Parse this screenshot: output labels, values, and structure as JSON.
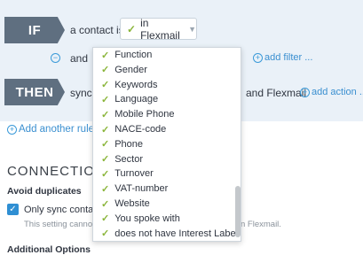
{
  "rule": {
    "if_tag": "IF",
    "condition_prefix": "a contact is",
    "condition_value": "in Flexmail",
    "and_label": "and",
    "add_filter": "add filter ...",
    "then_tag": "THEN",
    "action_prefix": "sync t",
    "action_suffix": "and Flexmail",
    "add_action": "add action ..."
  },
  "add_rule": "Add another rule .",
  "connections": {
    "title": "CONNECTION",
    "avoid_duplicates": "Avoid duplicates",
    "checkbox_label": "Only sync contac",
    "hint_left": "This setting canno",
    "hint_right": "n Flexmail.",
    "additional_options": "Additional Options"
  },
  "dropdown": {
    "items": [
      "Function",
      "Gender",
      "Keywords",
      "Language",
      "Mobile Phone",
      "NACE-code",
      "Phone",
      "Sector",
      "Turnover",
      "VAT-number",
      "Website",
      "You spoke with",
      "does not have Interest Label"
    ]
  },
  "colors": {
    "accent": "#3a8fd0",
    "check": "#8ab53a",
    "tag": "#5f6f80",
    "panel": "#eaf1f8"
  }
}
